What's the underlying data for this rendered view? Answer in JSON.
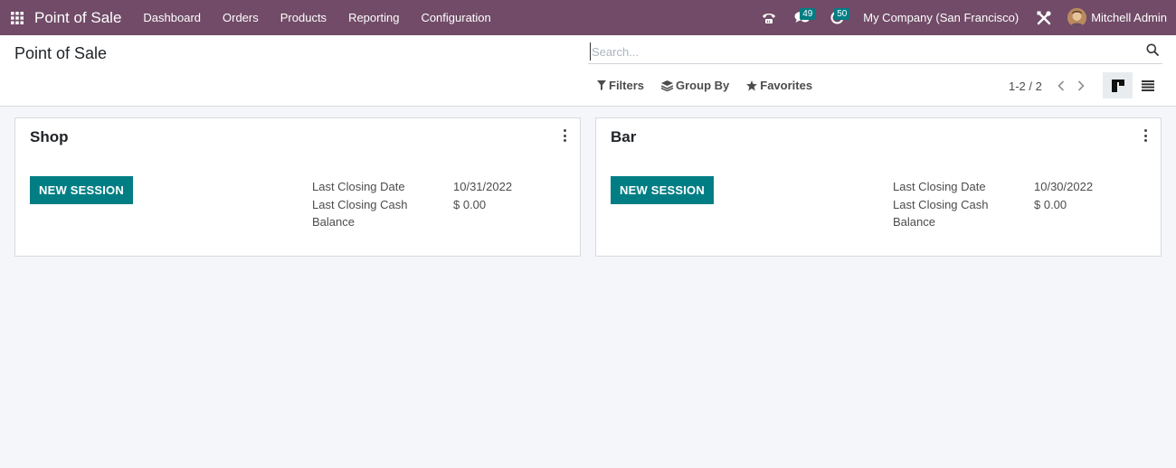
{
  "navbar": {
    "app_title": "Point of Sale",
    "menu": [
      {
        "label": "Dashboard"
      },
      {
        "label": "Orders"
      },
      {
        "label": "Products"
      },
      {
        "label": "Reporting"
      },
      {
        "label": "Configuration"
      }
    ],
    "messages_count": "49",
    "activities_count": "50",
    "company": "My Company (San Francisco)",
    "user_name": "Mitchell Admin"
  },
  "control_panel": {
    "breadcrumb": "Point of Sale",
    "search_placeholder": "Search...",
    "filters_label": "Filters",
    "group_by_label": "Group By",
    "favorites_label": "Favorites",
    "pager": "1-2 / 2",
    "active_view": "kanban"
  },
  "cards": [
    {
      "title": "Shop",
      "button_label": "NEW SESSION",
      "last_closing_date_label": "Last Closing Date",
      "last_closing_date": "10/31/2022",
      "last_closing_cash_label": "Last Closing Cash Balance",
      "last_closing_cash": "$ 0.00"
    },
    {
      "title": "Bar",
      "button_label": "NEW SESSION",
      "last_closing_date_label": "Last Closing Date",
      "last_closing_date": "10/30/2022",
      "last_closing_cash_label": "Last Closing Cash Balance",
      "last_closing_cash": "$ 0.00"
    }
  ],
  "colors": {
    "navbar": "#714b67",
    "primary_button": "#017e84",
    "badge": "#017e84"
  }
}
